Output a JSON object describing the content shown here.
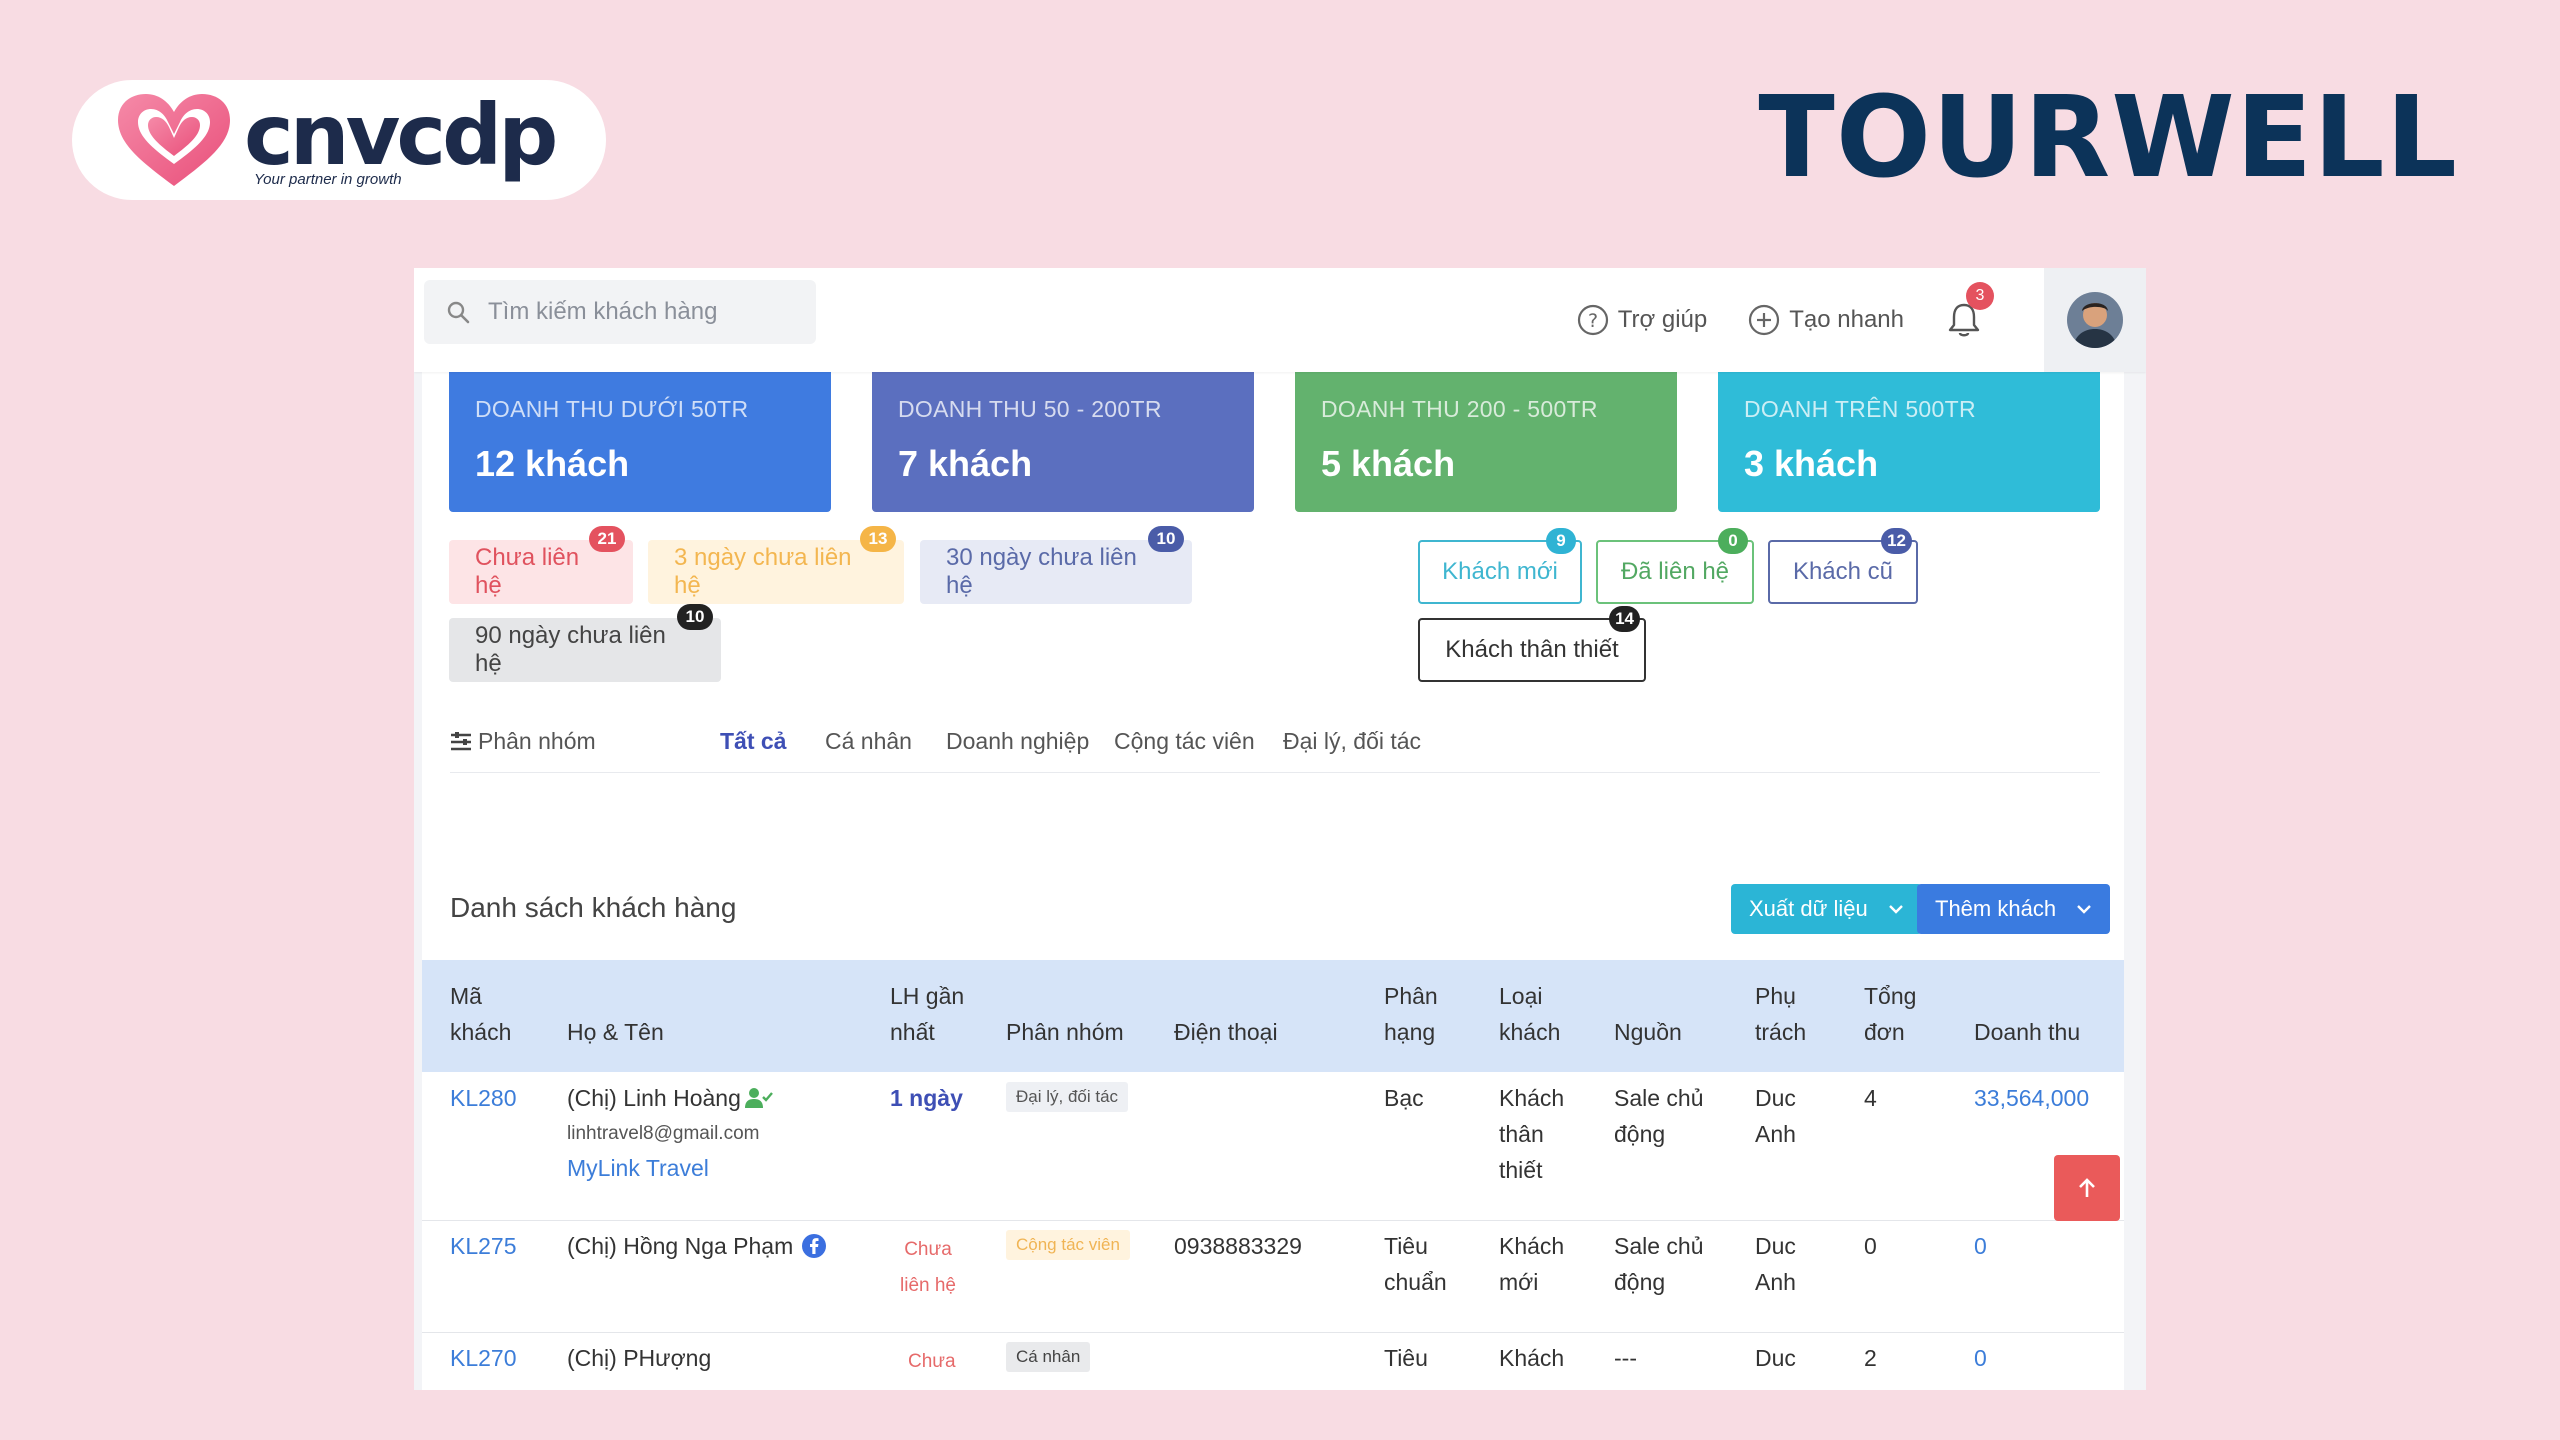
{
  "branding": {
    "logo_name": "cnvcdp",
    "logo_tagline": "Your partner in growth",
    "product_name": "TOURWELL"
  },
  "topbar": {
    "search_placeholder": "Tìm kiếm khách hàng",
    "help_label": "Trợ giúp",
    "quick_create_label": "Tạo nhanh",
    "notification_count": "3"
  },
  "revenue_cards": [
    {
      "label": "DOANH THU DƯỚI 50TR",
      "value": "12 khách",
      "color": "#3f7be0"
    },
    {
      "label": "DOANH THU 50 - 200TR",
      "value": "7 khách",
      "color": "#5b6fbf"
    },
    {
      "label": "DOANH THU 200 - 500TR",
      "value": "5 khách",
      "color": "#63b26e"
    },
    {
      "label": "DOANH TRÊN 500TR",
      "value": "3 khách",
      "color": "#2fbcd8"
    }
  ],
  "contact_filters": [
    {
      "label": "Chưa liên hệ",
      "count": "21"
    },
    {
      "label": "3 ngày chưa liên hệ",
      "count": "13"
    },
    {
      "label": "30 ngày chưa liên hệ",
      "count": "10"
    },
    {
      "label": "90 ngày chưa liên hệ",
      "count": "10"
    }
  ],
  "type_filters": [
    {
      "label": "Khách mới",
      "count": "9"
    },
    {
      "label": "Đã liên hệ",
      "count": "0"
    },
    {
      "label": "Khách cũ",
      "count": "12"
    },
    {
      "label": "Khách thân thiết",
      "count": "14"
    }
  ],
  "groups": {
    "label": "Phân nhóm",
    "tabs": [
      "Tất cả",
      "Cá nhân",
      "Doanh nghiệp",
      "Cộng tác viên",
      "Đại lý, đối tác"
    ]
  },
  "list": {
    "title": "Danh sách khách hàng",
    "export_label": "Xuất dữ liệu",
    "add_label": "Thêm khách",
    "columns": {
      "code": [
        "Mã",
        "khách"
      ],
      "name": "Họ & Tên",
      "last_contact": [
        "LH gần",
        "nhất"
      ],
      "group": "Phân nhóm",
      "phone": "Điện thoại",
      "rank": [
        "Phân",
        "hạng"
      ],
      "type": [
        "Loại",
        "khách"
      ],
      "source": "Nguồn",
      "owner": [
        "Phụ",
        "trách"
      ],
      "orders": [
        "Tổng",
        "đơn"
      ],
      "revenue": "Doanh thu"
    },
    "rows": [
      {
        "code": "KL280",
        "name": "(Chị) Linh Hoàng",
        "email": "linhtravel8@gmail.com",
        "company": "MyLink Travel",
        "last_contact": "1 ngày",
        "group": "Đại lý, đối tác",
        "phone": "",
        "rank": "Bạc",
        "type": [
          "Khách",
          "thân",
          "thiết"
        ],
        "source": [
          "Sale chủ",
          "động"
        ],
        "owner": [
          "Duc",
          "Anh"
        ],
        "orders": "4",
        "revenue": "33,564,000"
      },
      {
        "code": "KL275",
        "name": "(Chị) Hồng Nga Phạm",
        "last_contact": [
          "Chưa",
          "liên hệ"
        ],
        "group": "Cộng tác viên",
        "phone": "0938883329",
        "rank": [
          "Tiêu",
          "chuẩn"
        ],
        "type": [
          "Khách",
          "mới"
        ],
        "source": [
          "Sale chủ",
          "động"
        ],
        "owner": [
          "Duc",
          "Anh"
        ],
        "orders": "0",
        "revenue": "0"
      },
      {
        "code": "KL270",
        "name": "(Chị) PHượng",
        "last_contact": "Chưa",
        "group": "Cá nhân",
        "phone": "",
        "rank": "Tiêu",
        "type": "Khách",
        "source": "---",
        "owner": "Duc",
        "orders": "2",
        "revenue": "0"
      }
    ]
  }
}
